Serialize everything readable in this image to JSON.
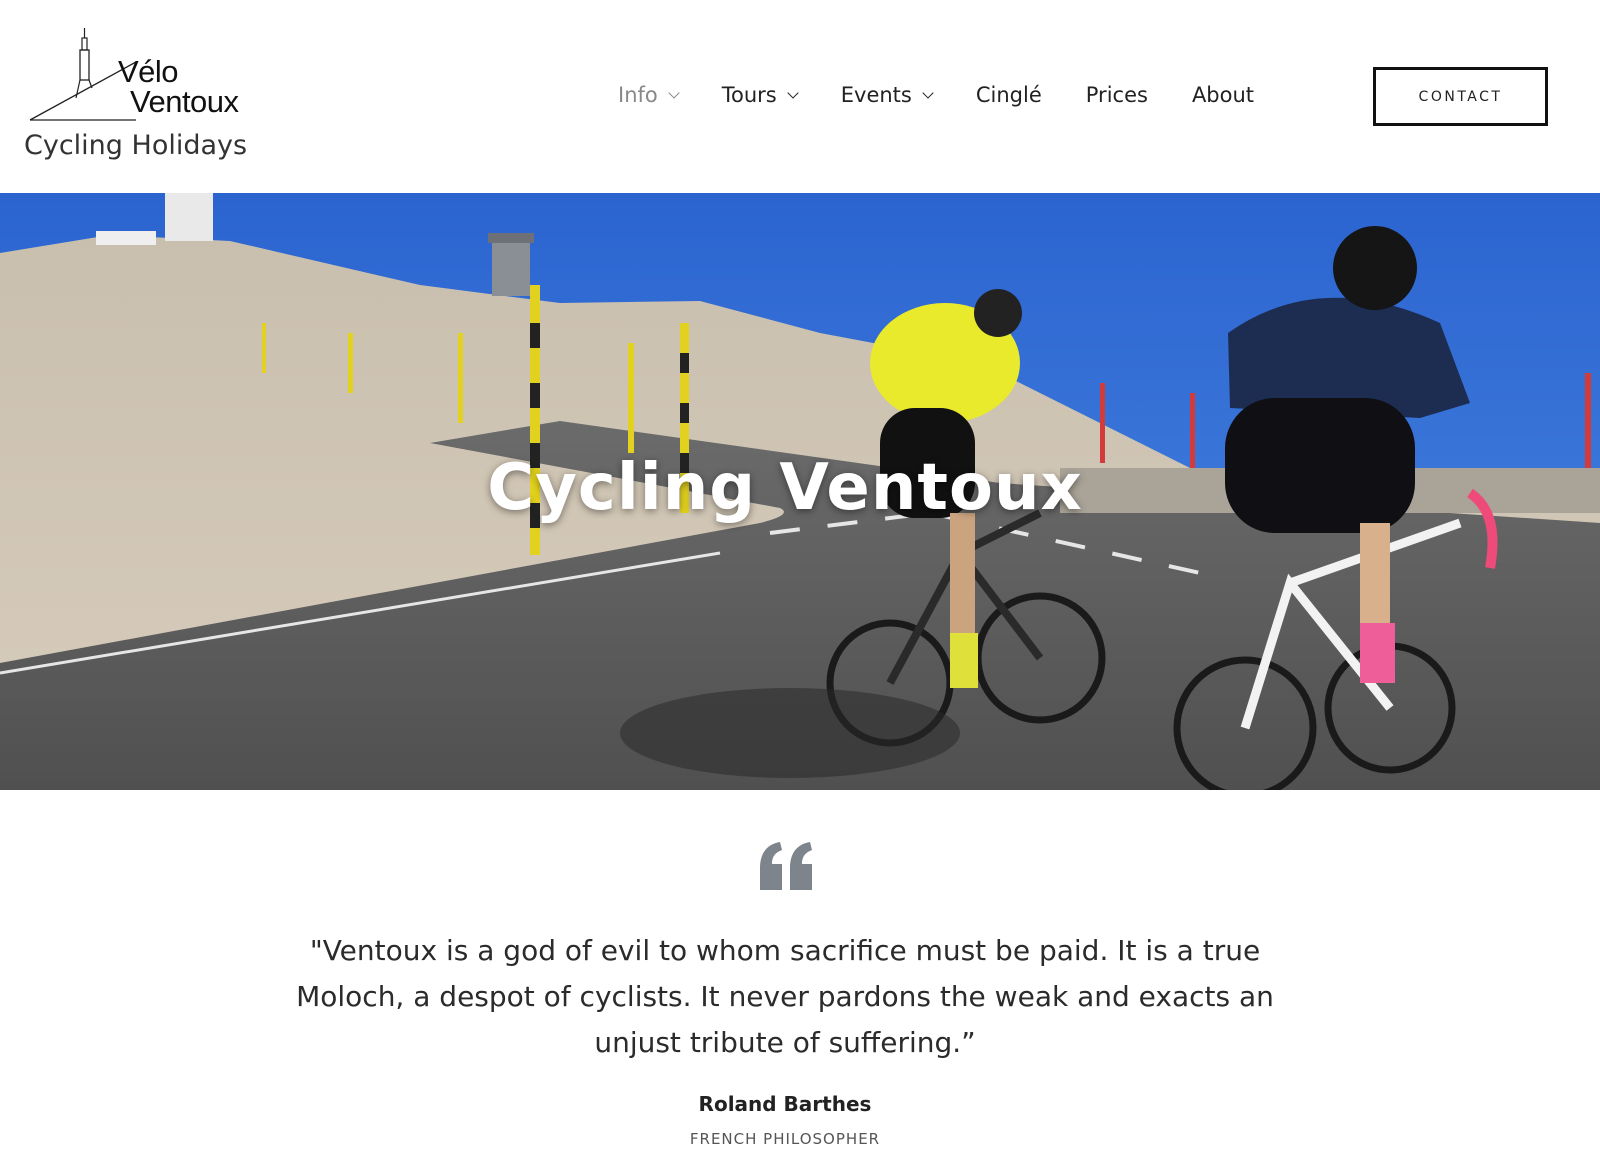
{
  "logo": {
    "line1": "Vélo",
    "line2": "Ventoux",
    "tagline": "Cycling Holidays",
    "icon": "mont-ventoux-tower-icon"
  },
  "nav": {
    "items": [
      {
        "label": "Info",
        "has_dropdown": true,
        "active": true
      },
      {
        "label": "Tours",
        "has_dropdown": true,
        "active": false
      },
      {
        "label": "Events",
        "has_dropdown": true,
        "active": false
      },
      {
        "label": "Cinglé",
        "has_dropdown": false,
        "active": false
      },
      {
        "label": "Prices",
        "has_dropdown": false,
        "active": false
      },
      {
        "label": "About",
        "has_dropdown": false,
        "active": false
      }
    ],
    "contact_label": "CONTACT"
  },
  "hero": {
    "title": "Cycling Ventoux"
  },
  "quote": {
    "icon": "quote-mark-icon",
    "text": "\"Ventoux is a god of evil to whom sacrifice must be paid. It is a true Moloch, a despot of cyclists. It never pardons the weak and exacts an unjust tribute of suffering.”",
    "author": "Roland Barthes",
    "role": "FRENCH PHILOSOPHER"
  },
  "colors": {
    "sky": "#2f6fd6",
    "mountain": "#cfc4b4",
    "road": "#5f5f5f",
    "jersey_yellow": "#e8e82a",
    "jersey_navy": "#1d2d52",
    "quote_icon": "#7d848c",
    "nav_active": "#888888"
  }
}
